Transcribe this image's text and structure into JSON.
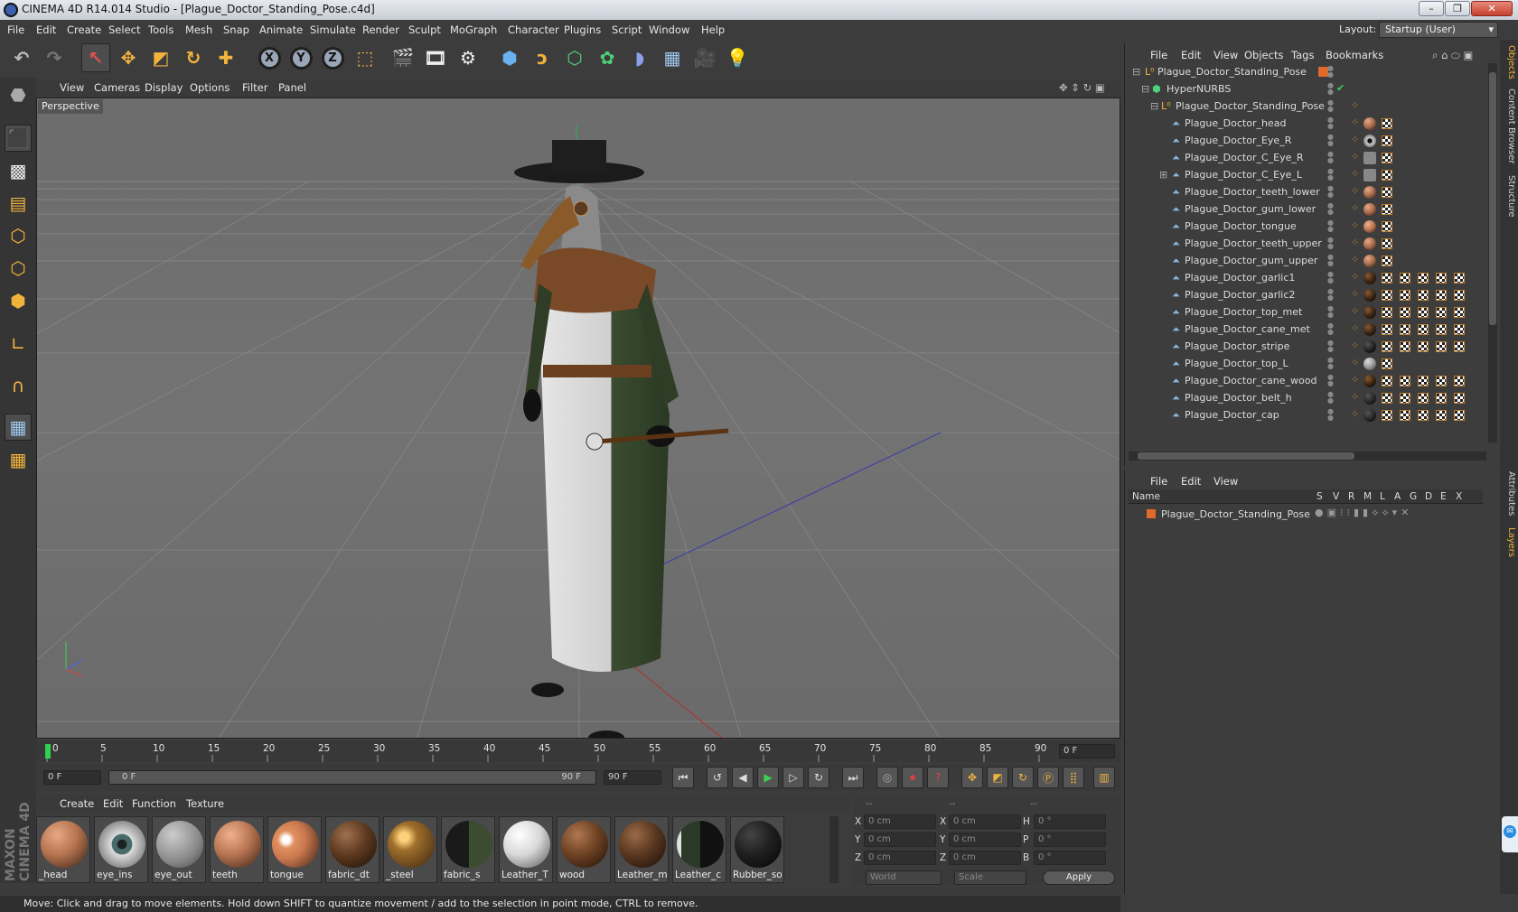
{
  "window": {
    "title": "CINEMA 4D R14.014 Studio - [Plague_Doctor_Standing_Pose.c4d]",
    "controls": [
      "–",
      "❐",
      "✕"
    ]
  },
  "menubar": {
    "items": [
      "File",
      "Edit",
      "Create",
      "Select",
      "Tools",
      "Mesh",
      "Snap",
      "Animate",
      "Simulate",
      "Render",
      "Sculpt",
      "MoGraph",
      "Character",
      "Plugins",
      "Script",
      "Window",
      "Help"
    ],
    "layout_label": "Layout:",
    "layout_value": "Startup (User)"
  },
  "toolbar": {
    "icons": [
      "undo-icon",
      "redo-icon",
      "live-selection-icon",
      "move-icon",
      "scale-icon",
      "rotate-icon",
      "add-icon",
      "x-axis-icon",
      "y-axis-icon",
      "z-axis-icon",
      "world-coordinates-icon",
      "render-view-icon",
      "render-picture-viewer-icon",
      "render-settings-icon",
      "cube-icon",
      "spline-icon",
      "nurbs-icon",
      "array-icon",
      "deformer-icon",
      "floor-icon",
      "camera-icon",
      "light-icon"
    ],
    "x": "X",
    "y": "Y",
    "z": "Z"
  },
  "viewport": {
    "menus": [
      "View",
      "Cameras",
      "Display",
      "Options",
      "Filter",
      "Panel"
    ],
    "label": "Perspective"
  },
  "timeline": {
    "ticks": [
      "0",
      "5",
      "10",
      "15",
      "20",
      "25",
      "30",
      "35",
      "40",
      "45",
      "50",
      "55",
      "60",
      "65",
      "70",
      "75",
      "80",
      "85",
      "90"
    ],
    "current": "0 F",
    "start": "0 F",
    "range_start": "0 F",
    "range_end": "90 F",
    "end": "90 F"
  },
  "materials": {
    "menus": [
      "Create",
      "Edit",
      "Function",
      "Texture"
    ],
    "items": [
      {
        "label": "_head",
        "color": "#b5744f"
      },
      {
        "label": "eye_ins",
        "color": "#6f7d7d"
      },
      {
        "label": "eye_out",
        "color": "#9a9a9a"
      },
      {
        "label": "teeth",
        "color": "#b77552"
      },
      {
        "label": "tongue",
        "color": "#c9784f"
      },
      {
        "label": "fabric_dt",
        "color": "#5e3a1f"
      },
      {
        "label": "_steel",
        "color": "#6e4b1c"
      },
      {
        "label": "fabric_s",
        "color": "#2a3324"
      },
      {
        "label": "Leather_T",
        "color": "#d8d8d8"
      },
      {
        "label": "wood",
        "color": "#6e4224"
      },
      {
        "label": "Leather_m",
        "color": "#5a3820"
      },
      {
        "label": "Leather_c",
        "color": "#2b3a28"
      },
      {
        "label": "Rubber_so",
        "color": "#1f1f1f"
      }
    ]
  },
  "coords": {
    "headers": [
      "--",
      "--",
      "--"
    ],
    "rows": [
      {
        "a": "X",
        "av": "0 cm",
        "b": "X",
        "bv": "0 cm",
        "c": "H",
        "cv": "0 °"
      },
      {
        "a": "Y",
        "av": "0 cm",
        "b": "Y",
        "bv": "0 cm",
        "c": "P",
        "cv": "0 °"
      },
      {
        "a": "Z",
        "av": "0 cm",
        "b": "Z",
        "bv": "0 cm",
        "c": "B",
        "cv": "0 °"
      }
    ],
    "mode": "World",
    "type": "Scale",
    "apply": "Apply"
  },
  "status": "Move: Click and drag to move elements. Hold down SHIFT to quantize movement / add to the selection in point mode, CTRL to remove.",
  "object_manager": {
    "menus": [
      "File",
      "Edit",
      "View",
      "Objects",
      "Tags",
      "Bookmarks"
    ],
    "objects": [
      {
        "name": "Plague_Doctor_Standing_Pose",
        "level": 0,
        "tags": 0
      },
      {
        "name": "HyperNURBS",
        "level": 1,
        "tags": 0
      },
      {
        "name": "Plague_Doctor_Standing_Pose",
        "level": 2,
        "tags": 0
      },
      {
        "name": "Plague_Doctor_head",
        "level": 3,
        "tags": 1,
        "ball": "#a46a4c"
      },
      {
        "name": "Plague_Doctor_Eye_R",
        "level": 3,
        "tags": 1,
        "ball": "#555"
      },
      {
        "name": "Plague_Doctor_C_Eye_R",
        "level": 3,
        "tags": 1,
        "ball": "#888"
      },
      {
        "name": "Plague_Doctor_C_Eye_L",
        "level": 3,
        "tags": 1,
        "ball": "#888"
      },
      {
        "name": "Plague_Doctor_teeth_lower",
        "level": 3,
        "tags": 1,
        "ball": "#a46a4c"
      },
      {
        "name": "Plague_Doctor_gum_lower",
        "level": 3,
        "tags": 1,
        "ball": "#a46a4c"
      },
      {
        "name": "Plague_Doctor_tongue",
        "level": 3,
        "tags": 1,
        "ball": "#b8734f"
      },
      {
        "name": "Plague_Doctor_teeth_upper",
        "level": 3,
        "tags": 1,
        "ball": "#a46a4c"
      },
      {
        "name": "Plague_Doctor_gum_upper",
        "level": 3,
        "tags": 1,
        "ball": "#a46a4c"
      },
      {
        "name": "Plague_Doctor_garlic1",
        "level": 3,
        "tags": 5,
        "ball": "#3a2514"
      },
      {
        "name": "Plague_Doctor_garlic2",
        "level": 3,
        "tags": 5,
        "ball": "#3a2514"
      },
      {
        "name": "Plague_Doctor_top_met",
        "level": 3,
        "tags": 5,
        "ball": "#3a2514"
      },
      {
        "name": "Plague_Doctor_cane_met",
        "level": 3,
        "tags": 5,
        "ball": "#3a2514"
      },
      {
        "name": "Plague_Doctor_stripe",
        "level": 3,
        "tags": 5,
        "ball": "#222"
      },
      {
        "name": "Plague_Doctor_top_L",
        "level": 3,
        "tags": 1,
        "ball": "#999"
      },
      {
        "name": "Plague_Doctor_cane_wood",
        "level": 3,
        "tags": 5,
        "ball": "#3a2514"
      },
      {
        "name": "Plague_Doctor_belt_h",
        "level": 3,
        "tags": 5,
        "ball": "#2a2a2a"
      },
      {
        "name": "Plague_Doctor_cap",
        "level": 3,
        "tags": 5,
        "ball": "#2a2a2a"
      }
    ]
  },
  "layer_manager": {
    "menus": [
      "File",
      "Edit",
      "View"
    ],
    "columns": [
      "Name",
      "S",
      "V",
      "R",
      "M",
      "L",
      "A",
      "G",
      "D",
      "E",
      "X"
    ],
    "layer": "Plague_Doctor_Standing_Pose"
  },
  "right_tabs": [
    "Objects",
    "Content Browser",
    "Structure",
    "Attributes",
    "Layers"
  ],
  "vertical_logo": "MAXON CINEMA 4D"
}
